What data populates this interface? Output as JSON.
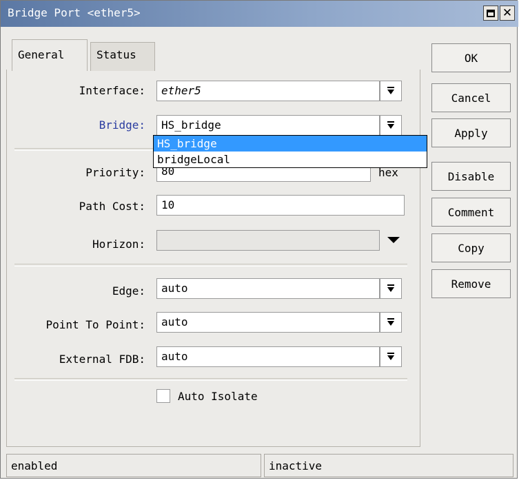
{
  "window": {
    "title": "Bridge Port <ether5>"
  },
  "tabs": [
    {
      "label": "General",
      "active": true
    },
    {
      "label": "Status",
      "active": false
    }
  ],
  "fields": {
    "interface": {
      "label": "Interface:",
      "value": "ether5"
    },
    "bridge": {
      "label": "Bridge:",
      "value": "HS_bridge"
    },
    "priority": {
      "label": "Priority:",
      "value": "80",
      "unit": "hex"
    },
    "path_cost": {
      "label": "Path Cost:",
      "value": "10"
    },
    "horizon": {
      "label": "Horizon:",
      "value": ""
    },
    "edge": {
      "label": "Edge:",
      "value": "auto"
    },
    "point_to_point": {
      "label": "Point To Point:",
      "value": "auto"
    },
    "external_fdb": {
      "label": "External FDB:",
      "value": "auto"
    }
  },
  "bridge_dropdown": {
    "options": [
      "HS_bridge",
      "bridgeLocal"
    ],
    "selected": "HS_bridge"
  },
  "auto_isolate": {
    "label": "Auto Isolate",
    "checked": false
  },
  "buttons": {
    "ok": "OK",
    "cancel": "Cancel",
    "apply": "Apply",
    "disable": "Disable",
    "comment": "Comment",
    "copy": "Copy",
    "remove": "Remove"
  },
  "status": {
    "left": "enabled",
    "right": "inactive"
  },
  "colors": {
    "titlebar": "#5b78a4",
    "selection": "#3399ff",
    "bridge_label": "#2a3ca0"
  }
}
